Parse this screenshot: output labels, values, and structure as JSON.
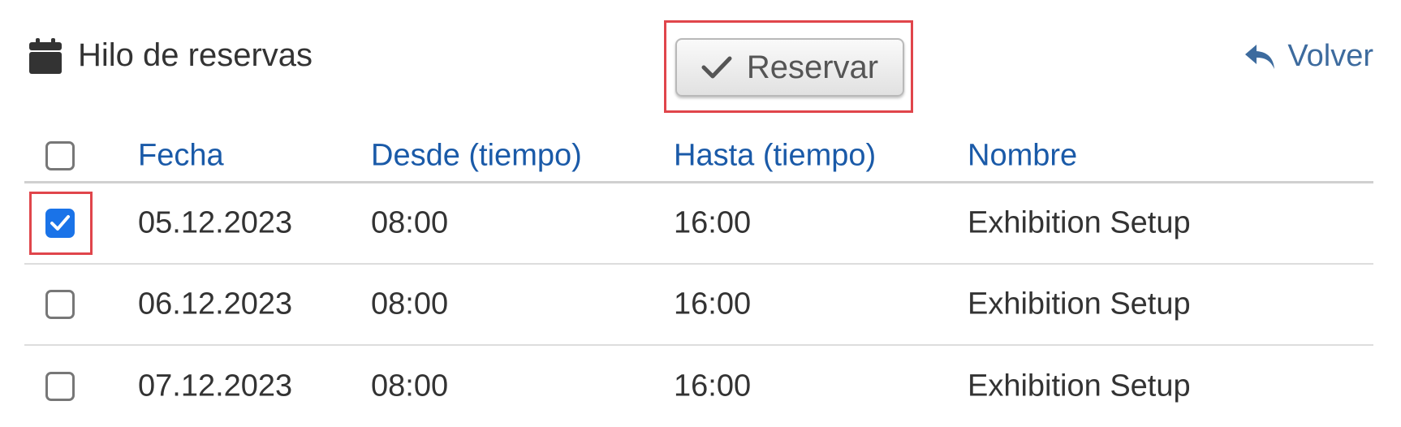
{
  "header": {
    "title": "Hilo de reservas",
    "title_icon": "calendar-icon",
    "reserve_label": "Reservar",
    "reserve_icon": "check-icon",
    "back_label": "Volver",
    "back_icon": "reply-arrow-icon"
  },
  "table": {
    "columns": [
      "Fecha",
      "Desde (tiempo)",
      "Hasta (tiempo)",
      "Nombre"
    ],
    "select_all_checked": false,
    "rows": [
      {
        "checked": true,
        "fecha": "05.12.2023",
        "desde": "08:00",
        "hasta": "16:00",
        "nombre": "Exhibition Setup"
      },
      {
        "checked": false,
        "fecha": "06.12.2023",
        "desde": "08:00",
        "hasta": "16:00",
        "nombre": "Exhibition Setup"
      },
      {
        "checked": false,
        "fecha": "07.12.2023",
        "desde": "08:00",
        "hasta": "16:00",
        "nombre": "Exhibition Setup"
      }
    ]
  },
  "colors": {
    "link_blue": "#1a5aa8",
    "checkbox_blue": "#1a73e8",
    "highlight_red": "#e0454b",
    "back_link": "#3d6b9e"
  }
}
